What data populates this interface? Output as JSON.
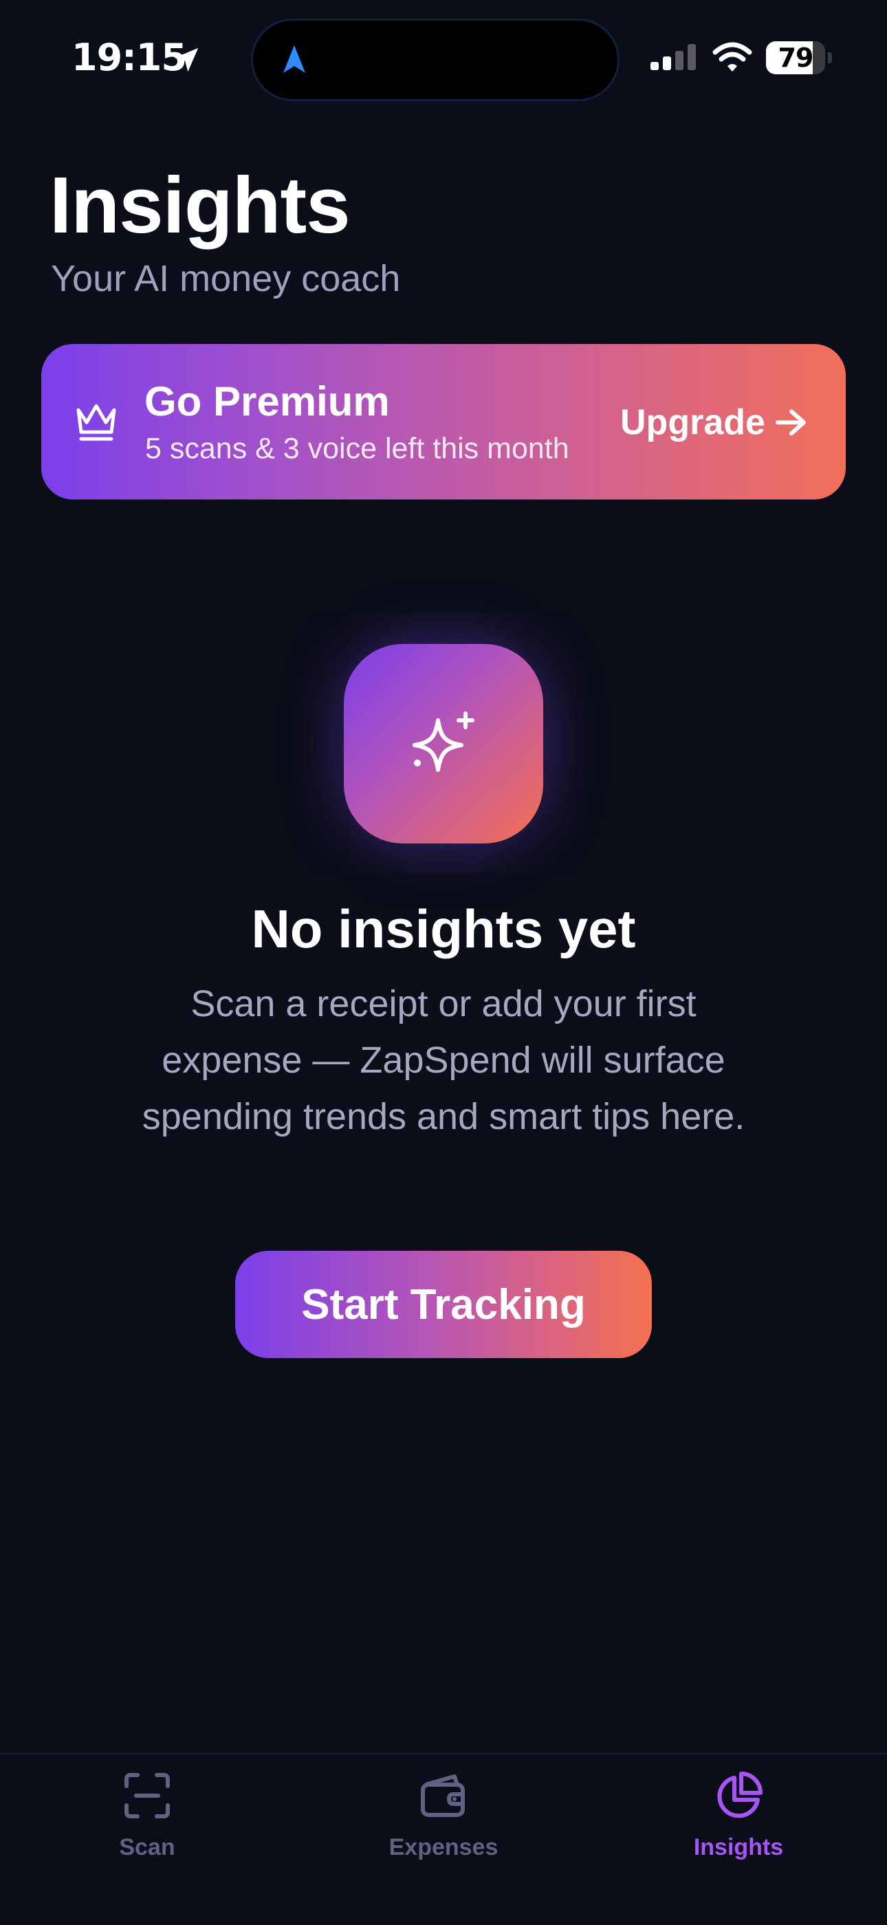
{
  "status_bar": {
    "time": "19:15",
    "battery": "79",
    "battery_level": 0.79
  },
  "header": {
    "title": "Insights",
    "subtitle": "Your AI money coach"
  },
  "premium_banner": {
    "title": "Go Premium",
    "subtitle": "5 scans & 3 voice left this month",
    "cta_label": "Upgrade",
    "icon": "crown-icon",
    "gradient": [
      "#7B3FEA",
      "#C95E9C",
      "#F26F5A"
    ]
  },
  "empty_state": {
    "icon": "sparkle-icon",
    "title": "No insights yet",
    "body": "Scan a receipt or add your first expense — ZapSpend will surface spending trends and smart tips here.",
    "cta_label": "Start Tracking"
  },
  "tabs": [
    {
      "label": "Scan",
      "icon": "scan-icon",
      "active": false
    },
    {
      "label": "Expenses",
      "icon": "wallet-icon",
      "active": false
    },
    {
      "label": "Insights",
      "icon": "pie-chart-icon",
      "active": true
    }
  ],
  "colors": {
    "background": "#0B0D19",
    "accent": "#A855F7",
    "inactive_tab": "#5F6383",
    "muted_text": "#9EA0BE"
  }
}
